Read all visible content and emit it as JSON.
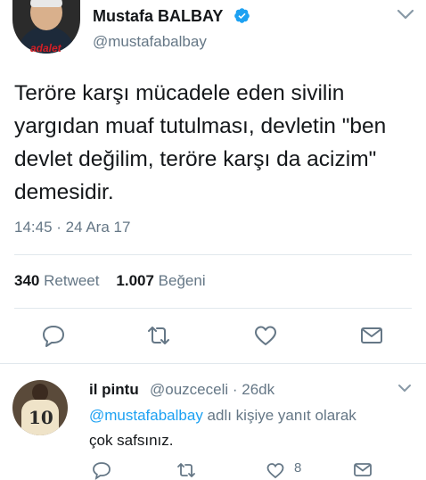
{
  "tweet": {
    "display_name": "Mustafa BALBAY",
    "handle": "@mustafabalbay",
    "avatar_brand_text": "adalet",
    "text": "Teröre karşı mücadele eden sivilin yargıdan muaf tutulması, devletin \"ben devlet değilim, teröre karşı da acizim\" demesidir.",
    "timestamp": "14:45 · 24 Ara 17",
    "retweet_count": "340",
    "retweet_label": "Retweet",
    "like_count": "1.007",
    "like_label": "Beğeni",
    "icons": [
      "reply-icon",
      "retweet-icon",
      "like-icon",
      "direct-message-icon"
    ]
  },
  "reply": {
    "display_name": "il pintu",
    "handle_time": "@ouzceceli · 26dk",
    "avatar_jersey_number": "10",
    "mention": "@mustafabalbay",
    "reply_to_suffix": " adlı kişiye yanıt olarak",
    "text": "çok safsınız.",
    "like_count": "8"
  },
  "colors": {
    "accent": "#1da1f2",
    "secondary_text": "#657786",
    "primary_text": "#14171a",
    "divider": "#e1e8ed",
    "brand_red": "#d41f26"
  }
}
